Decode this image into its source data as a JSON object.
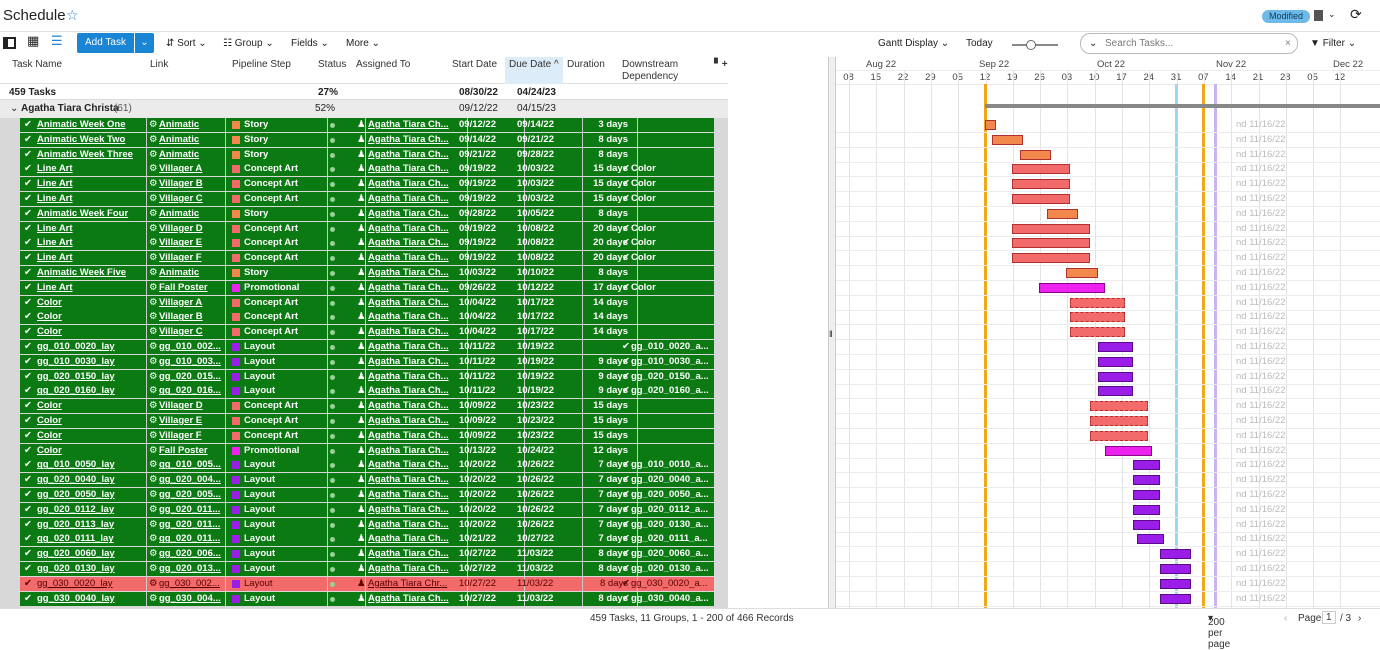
{
  "header": {
    "title": "Schedule",
    "badge": "Modified"
  },
  "toolbar": {
    "add_task": "Add Task",
    "sort": "Sort",
    "group": "Group",
    "fields": "Fields",
    "more": "More",
    "gantt_display": "Gantt Display",
    "today": "Today",
    "search_placeholder": "Search Tasks...",
    "filter": "Filter"
  },
  "columns": {
    "task_name": "Task Name",
    "link": "Link",
    "pipeline_step": "Pipeline Step",
    "status": "Status",
    "assigned_to": "Assigned To",
    "start_date": "Start Date",
    "due_date": "Due Date",
    "duration": "Duration",
    "downstream": "Downstream",
    "dependency": "Dependency"
  },
  "summary": {
    "label": "459 Tasks",
    "status": "27%",
    "start": "08/30/22",
    "due": "04/24/23"
  },
  "group": {
    "label": "Agatha Tiara Christa",
    "count": "(61)",
    "status": "52%",
    "start": "09/12/22",
    "due": "04/15/23"
  },
  "rows": [
    {
      "task": "Animatic Week One",
      "link": "Animatic",
      "step": "Story",
      "stepcolor": "#f2884b",
      "assigned": "Agatha Tiara Ch...",
      "start": "09/12/22",
      "due": "09/14/22",
      "duration": "3 days",
      "down": ""
    },
    {
      "task": "Animatic Week Two",
      "link": "Animatic",
      "step": "Story",
      "stepcolor": "#f2884b",
      "assigned": "Agatha Tiara Ch...",
      "start": "09/14/22",
      "due": "09/21/22",
      "duration": "8 days",
      "down": ""
    },
    {
      "task": "Animatic Week Three",
      "link": "Animatic",
      "step": "Story",
      "stepcolor": "#f2884b",
      "assigned": "Agatha Tiara Ch...",
      "start": "09/21/22",
      "due": "09/28/22",
      "duration": "8 days",
      "down": ""
    },
    {
      "task": "Line Art",
      "link": "Villager A",
      "step": "Concept Art",
      "stepcolor": "#f26a6a",
      "assigned": "Agatha Tiara Ch...",
      "start": "09/19/22",
      "due": "10/03/22",
      "duration": "15 days",
      "down": "Color"
    },
    {
      "task": "Line Art",
      "link": "Villager B",
      "step": "Concept Art",
      "stepcolor": "#f26a6a",
      "assigned": "Agatha Tiara Ch...",
      "start": "09/19/22",
      "due": "10/03/22",
      "duration": "15 days",
      "down": "Color"
    },
    {
      "task": "Line Art",
      "link": "Villager C",
      "step": "Concept Art",
      "stepcolor": "#f26a6a",
      "assigned": "Agatha Tiara Ch...",
      "start": "09/19/22",
      "due": "10/03/22",
      "duration": "15 days",
      "down": "Color"
    },
    {
      "task": "Animatic Week Four",
      "link": "Animatic",
      "step": "Story",
      "stepcolor": "#f2884b",
      "assigned": "Agatha Tiara Ch...",
      "start": "09/28/22",
      "due": "10/05/22",
      "duration": "8 days",
      "down": ""
    },
    {
      "task": "Line Art",
      "link": "Villager D",
      "step": "Concept Art",
      "stepcolor": "#f26a6a",
      "assigned": "Agatha Tiara Ch...",
      "start": "09/19/22",
      "due": "10/08/22",
      "duration": "20 days",
      "down": "Color"
    },
    {
      "task": "Line Art",
      "link": "Villager E",
      "step": "Concept Art",
      "stepcolor": "#f26a6a",
      "assigned": "Agatha Tiara Ch...",
      "start": "09/19/22",
      "due": "10/08/22",
      "duration": "20 days",
      "down": "Color"
    },
    {
      "task": "Line Art",
      "link": "Villager F",
      "step": "Concept Art",
      "stepcolor": "#f26a6a",
      "assigned": "Agatha Tiara Ch...",
      "start": "09/19/22",
      "due": "10/08/22",
      "duration": "20 days",
      "down": "Color"
    },
    {
      "task": "Animatic Week Five",
      "link": "Animatic",
      "step": "Story",
      "stepcolor": "#f2884b",
      "assigned": "Agatha Tiara Ch...",
      "start": "10/03/22",
      "due": "10/10/22",
      "duration": "8 days",
      "down": ""
    },
    {
      "task": "Line Art",
      "link": "Fall Poster",
      "step": "Promotional",
      "stepcolor": "#ee22ee",
      "assigned": "Agatha Tiara Ch...",
      "start": "09/26/22",
      "due": "10/12/22",
      "duration": "17 days",
      "down": "Color"
    },
    {
      "task": "Color",
      "link": "Villager A",
      "step": "Concept Art",
      "stepcolor": "#f26a6a",
      "assigned": "Agatha Tiara Ch...",
      "start": "10/04/22",
      "due": "10/17/22",
      "duration": "14 days",
      "down": ""
    },
    {
      "task": "Color",
      "link": "Villager B",
      "step": "Concept Art",
      "stepcolor": "#f26a6a",
      "assigned": "Agatha Tiara Ch...",
      "start": "10/04/22",
      "due": "10/17/22",
      "duration": "14 days",
      "down": ""
    },
    {
      "task": "Color",
      "link": "Villager C",
      "step": "Concept Art",
      "stepcolor": "#f26a6a",
      "assigned": "Agatha Tiara Ch...",
      "start": "10/04/22",
      "due": "10/17/22",
      "duration": "14 days",
      "down": ""
    },
    {
      "task": "gg_010_0020_lay",
      "link": "gg_010_002...",
      "step": "Layout",
      "stepcolor": "#9b1ee8",
      "assigned": "Agatha Tiara Ch...",
      "start": "10/11/22",
      "due": "10/19/22",
      "duration": "",
      "down": "gg_010_0020_a..."
    },
    {
      "task": "gg_010_0030_lay",
      "link": "gg_010_003...",
      "step": "Layout",
      "stepcolor": "#9b1ee8",
      "assigned": "Agatha Tiara Ch...",
      "start": "10/11/22",
      "due": "10/19/22",
      "duration": "9 days",
      "down": "gg_010_0030_a..."
    },
    {
      "task": "gg_020_0150_lay",
      "link": "gg_020_015...",
      "step": "Layout",
      "stepcolor": "#9b1ee8",
      "assigned": "Agatha Tiara Ch...",
      "start": "10/11/22",
      "due": "10/19/22",
      "duration": "9 days",
      "down": "gg_020_0150_a..."
    },
    {
      "task": "gg_020_0160_lay",
      "link": "gg_020_016...",
      "step": "Layout",
      "stepcolor": "#9b1ee8",
      "assigned": "Agatha Tiara Ch...",
      "start": "10/11/22",
      "due": "10/19/22",
      "duration": "9 days",
      "down": "gg_020_0160_a..."
    },
    {
      "task": "Color",
      "link": "Villager D",
      "step": "Concept Art",
      "stepcolor": "#f26a6a",
      "assigned": "Agatha Tiara Ch...",
      "start": "10/09/22",
      "due": "10/23/22",
      "duration": "15 days",
      "down": ""
    },
    {
      "task": "Color",
      "link": "Villager E",
      "step": "Concept Art",
      "stepcolor": "#f26a6a",
      "assigned": "Agatha Tiara Ch...",
      "start": "10/09/22",
      "due": "10/23/22",
      "duration": "15 days",
      "down": ""
    },
    {
      "task": "Color",
      "link": "Villager F",
      "step": "Concept Art",
      "stepcolor": "#f26a6a",
      "assigned": "Agatha Tiara Ch...",
      "start": "10/09/22",
      "due": "10/23/22",
      "duration": "15 days",
      "down": ""
    },
    {
      "task": "Color",
      "link": "Fall Poster",
      "step": "Promotional",
      "stepcolor": "#ee22ee",
      "assigned": "Agatha Tiara Ch...",
      "start": "10/13/22",
      "due": "10/24/22",
      "duration": "12 days",
      "down": ""
    },
    {
      "task": "gg_010_0050_lay",
      "link": "gg_010_005...",
      "step": "Layout",
      "stepcolor": "#9b1ee8",
      "assigned": "Agatha Tiara Ch...",
      "start": "10/20/22",
      "due": "10/26/22",
      "duration": "7 days",
      "down": "gg_010_0010_a..."
    },
    {
      "task": "gg_020_0040_lay",
      "link": "gg_020_004...",
      "step": "Layout",
      "stepcolor": "#9b1ee8",
      "assigned": "Agatha Tiara Ch...",
      "start": "10/20/22",
      "due": "10/26/22",
      "duration": "7 days",
      "down": "gg_020_0040_a..."
    },
    {
      "task": "gg_020_0050_lay",
      "link": "gg_020_005...",
      "step": "Layout",
      "stepcolor": "#9b1ee8",
      "assigned": "Agatha Tiara Ch...",
      "start": "10/20/22",
      "due": "10/26/22",
      "duration": "7 days",
      "down": "gg_020_0050_a..."
    },
    {
      "task": "gg_020_0112_lay",
      "link": "gg_020_011...",
      "step": "Layout",
      "stepcolor": "#9b1ee8",
      "assigned": "Agatha Tiara Ch...",
      "start": "10/20/22",
      "due": "10/26/22",
      "duration": "7 days",
      "down": "gg_020_0112_a..."
    },
    {
      "task": "gg_020_0113_lay",
      "link": "gg_020_011...",
      "step": "Layout",
      "stepcolor": "#9b1ee8",
      "assigned": "Agatha Tiara Ch...",
      "start": "10/20/22",
      "due": "10/26/22",
      "duration": "7 days",
      "down": "gg_020_0130_a..."
    },
    {
      "task": "gg_020_0111_lay",
      "link": "gg_020_011...",
      "step": "Layout",
      "stepcolor": "#9b1ee8",
      "assigned": "Agatha Tiara Ch...",
      "start": "10/21/22",
      "due": "10/27/22",
      "duration": "7 days",
      "down": "gg_020_0111_a..."
    },
    {
      "task": "gg_020_0060_lay",
      "link": "gg_020_006...",
      "step": "Layout",
      "stepcolor": "#9b1ee8",
      "assigned": "Agatha Tiara Ch...",
      "start": "10/27/22",
      "due": "11/03/22",
      "duration": "8 days",
      "down": "gg_020_0060_a..."
    },
    {
      "task": "gg_020_0130_lay",
      "link": "gg_020_013...",
      "step": "Layout",
      "stepcolor": "#9b1ee8",
      "assigned": "Agatha Tiara Ch...",
      "start": "10/27/22",
      "due": "11/03/22",
      "duration": "8 days",
      "down": "gg_020_0130_a..."
    },
    {
      "task": "gg_030_0020_lay",
      "link": "gg_030_002...",
      "step": "Layout",
      "stepcolor": "#9b1ee8",
      "assigned": "Agatha Tiara Chr...",
      "start": "10/27/22",
      "due": "11/03/22",
      "duration": "8 days",
      "down": "gg_030_0020_a...",
      "red": true
    },
    {
      "task": "gg_030_0040_lay",
      "link": "gg_030_004...",
      "step": "Layout",
      "stepcolor": "#9b1ee8",
      "assigned": "Agatha Tiara Ch...",
      "start": "10/27/22",
      "due": "11/03/22",
      "duration": "8 days",
      "down": "gg_030_0040_a..."
    }
  ],
  "gantt": {
    "months": [
      "Aug 22",
      "Sep 22",
      "Oct 22",
      "Nov 22",
      "Dec 22"
    ],
    "days": [
      "08",
      "15",
      "22",
      "29",
      "05",
      "12",
      "19",
      "26",
      "03",
      "10",
      "17",
      "24",
      "31",
      "07",
      "14",
      "21",
      "28",
      "05",
      "12"
    ],
    "end_label": "nd 11/16/22"
  },
  "footer": {
    "records": "459 Tasks, 11 Groups, 1 - 200 of 466 Records",
    "per_page": "200 per page",
    "page_label": "Page",
    "page_num": "1",
    "page_total": "/ 3"
  }
}
